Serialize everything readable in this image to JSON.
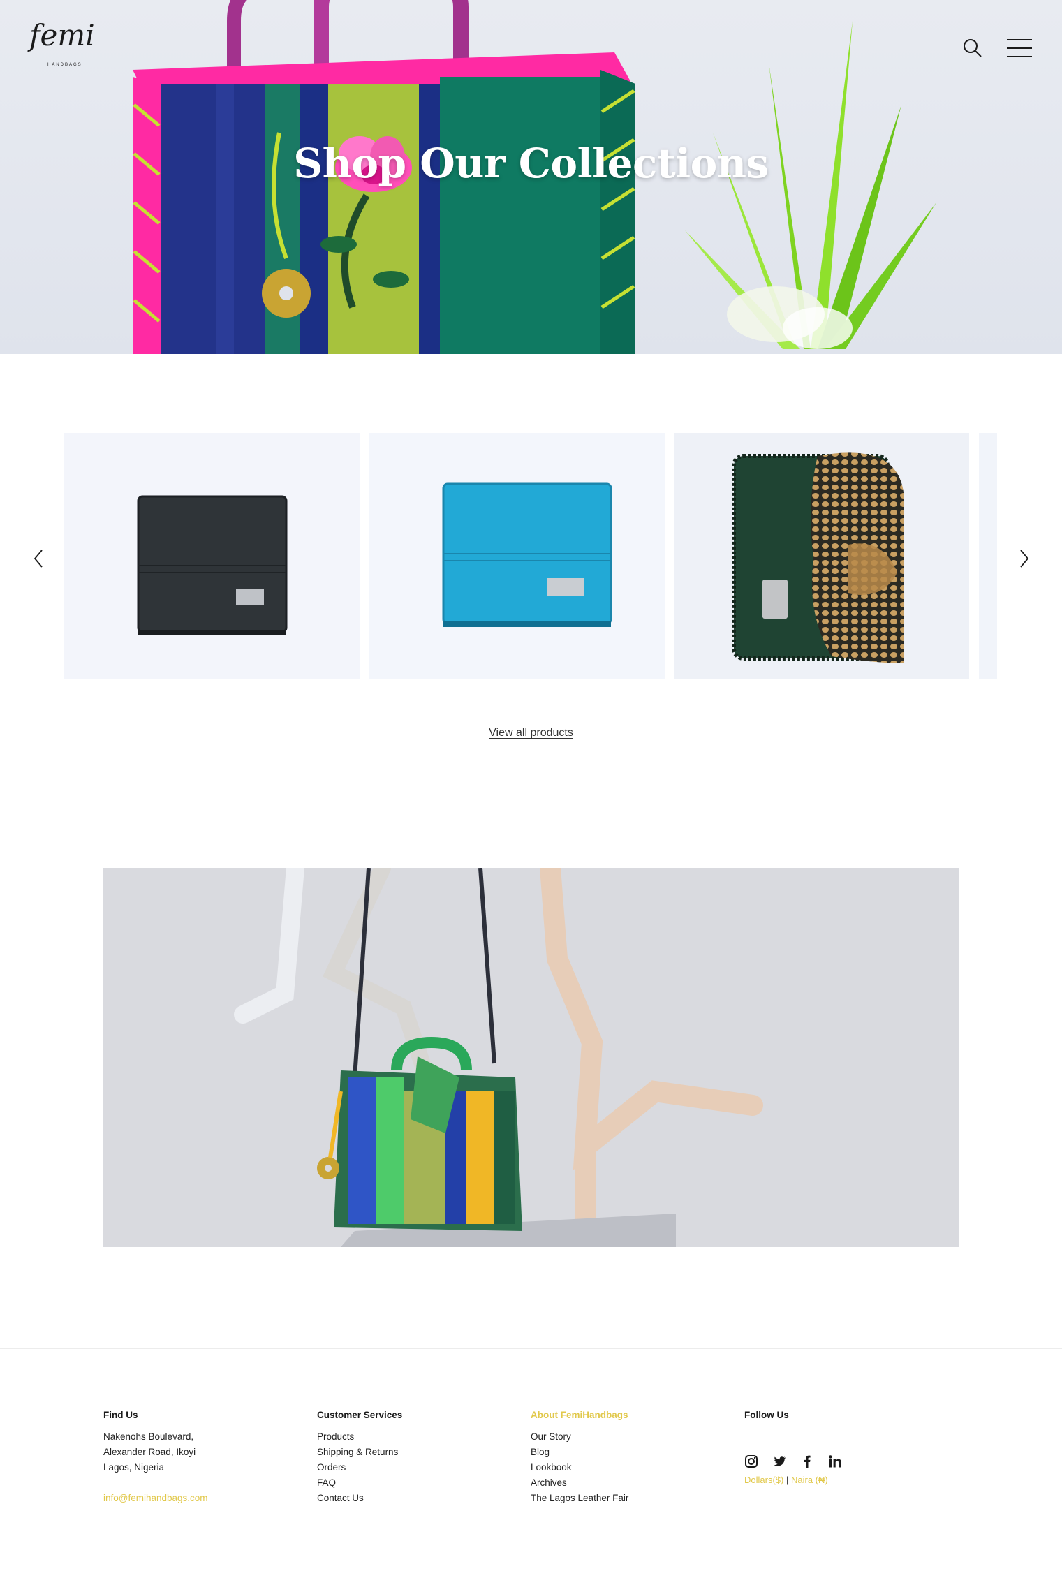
{
  "header": {
    "logo_text": "femi",
    "logo_sub": "HANDBAGS",
    "hero_title": "Shop Our Collections"
  },
  "carousel": {
    "products": [
      {
        "name": "Black leather wallet"
      },
      {
        "name": "Turquoise leather wallet"
      },
      {
        "name": "Green python clutch"
      }
    ],
    "view_all_label": "View all products"
  },
  "footer": {
    "find_us": {
      "heading": "Find Us",
      "address": [
        "Nakenohs Boulevard,",
        "Alexander Road, Ikoyi",
        "Lagos, Nigeria"
      ],
      "email": "info@femihandbags.com"
    },
    "customer_services": {
      "heading": "Customer Services",
      "links": [
        "Products",
        "Shipping & Returns",
        "Orders",
        "FAQ",
        "Contact Us"
      ]
    },
    "about": {
      "heading": "About FemiHandbags",
      "links": [
        "Our Story",
        "Blog",
        "Lookbook",
        "Archives",
        "The Lagos Leather Fair"
      ]
    },
    "follow": {
      "heading": "Follow Us",
      "social": [
        "instagram-icon",
        "twitter-icon",
        "facebook-icon",
        "linkedin-icon"
      ],
      "currency_dollars": "Dollars($)",
      "currency_sep": "|",
      "currency_naira": "Naira (₦)"
    }
  },
  "colors": {
    "accent": "#e1c84a",
    "text": "#1a1a1a"
  }
}
